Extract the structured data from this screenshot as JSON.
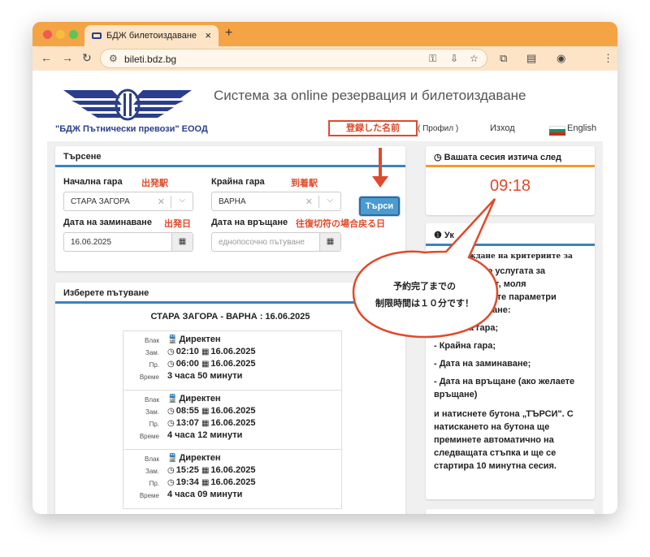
{
  "browser": {
    "tab_title": "БДЖ билетоиздаване",
    "url": "bileti.bdz.bg",
    "tab_close": "×",
    "new_tab": "+"
  },
  "header": {
    "system_title": "Система за online резервация и билетоиздаване",
    "company": "\"БДЖ Пътнически превози\" ЕООД",
    "username_annotation": "登録した名前",
    "profile": "( Профил )",
    "logout": "Изход",
    "language": "English"
  },
  "search": {
    "title": "Търсене",
    "from_label": "Начална гара",
    "from_annotation": "出発駅",
    "from_value": "СТАРА ЗАГОРА",
    "to_label": "Крайна гара",
    "to_annotation": "到着駅",
    "to_value": "ВАРНА",
    "search_button": "Търси",
    "depart_label": "Дата на заминаване",
    "depart_annotation": "出発日",
    "depart_value": "16.06.2025",
    "return_label": "Дата на връщане",
    "return_annotation": "往復切符の場合戻る日",
    "return_placeholder": "еднопосочно пътуване"
  },
  "results": {
    "title": "Изберете пътуване",
    "route": "СТАРА ЗАГОРА - ВАРНА : 16.06.2025",
    "labels": {
      "train": "Влак",
      "dep": "Зам.",
      "arr": "Пр.",
      "duration": "Време"
    },
    "trains": [
      {
        "type": "Директен",
        "dep_time": "02:10",
        "dep_date": "16.06.2025",
        "arr_time": "06:00",
        "arr_date": "16.06.2025",
        "duration": "3 часа 50 минути"
      },
      {
        "type": "Директен",
        "dep_time": "08:55",
        "dep_date": "16.06.2025",
        "arr_time": "13:07",
        "arr_date": "16.06.2025",
        "duration": "4 часа 12 минути"
      },
      {
        "type": "Директен",
        "dep_time": "15:25",
        "dep_date": "16.06.2025",
        "arr_time": "19:34",
        "arr_date": "16.06.2025",
        "duration": "4 часа 09 минути"
      }
    ]
  },
  "session": {
    "title": "Вашата сесия изтича след",
    "timer": "09:18"
  },
  "instructions": {
    "title": "Ук",
    "intro": "Въвеждане на критериите за търсене:",
    "lines": [
      "...олзвате услугата за",
      "... маршрут, моля",
      "... началните параметри",
      "...о пътуване:",
      "...лна гара;",
      "- Крайна гара;",
      "- Дата на заминаване;",
      "- Дата на връщане (ако желаете връщане)",
      "и натиснете бутона „ТЪРСИ\". С натискането на бутона ще преминете автоматично на следващата стъпка и ще се стартира 10 минутна сесия."
    ]
  },
  "callout": {
    "line1": "予約完了までの",
    "line2": "制限時間は１０分です！"
  },
  "colors": {
    "accent_blue": "#3a83bf",
    "accent_orange": "#f09c2e",
    "annotation_red": "#e04a2a",
    "brand_navy": "#2b3e8c"
  }
}
